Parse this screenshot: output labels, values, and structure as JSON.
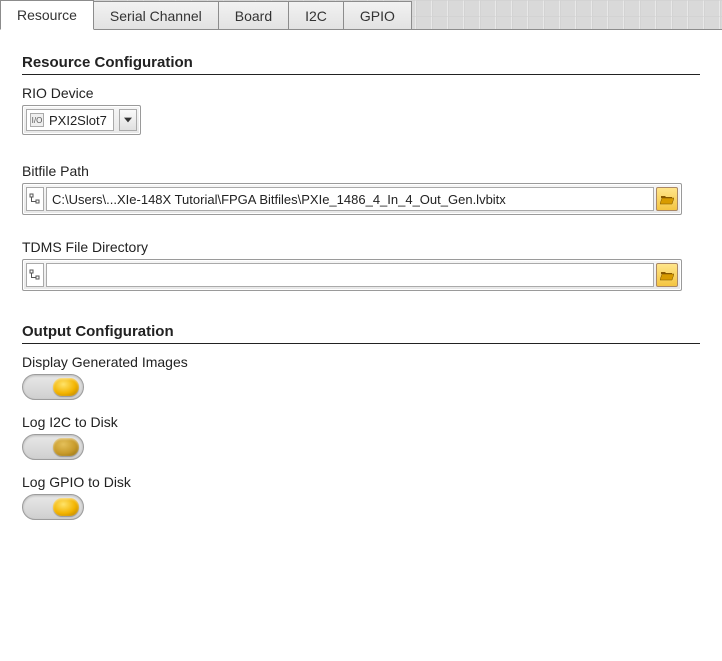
{
  "tabs": {
    "items": [
      {
        "label": "Resource",
        "active": true
      },
      {
        "label": "Serial Channel",
        "active": false
      },
      {
        "label": "Board",
        "active": false
      },
      {
        "label": "I2C",
        "active": false
      },
      {
        "label": "GPIO",
        "active": false
      }
    ]
  },
  "sections": {
    "resource_config": {
      "title": "Resource Configuration",
      "rio_device": {
        "label": "RIO Device",
        "value": "PXI2Slot7",
        "icon_name": "io-resource-icon"
      },
      "bitfile_path": {
        "label": "Bitfile Path",
        "value": "C:\\Users\\...XIe-148X Tutorial\\FPGA Bitfiles\\PXIe_1486_4_In_4_Out_Gen.lvbitx"
      },
      "tdms_dir": {
        "label": "TDMS File Directory",
        "value": ""
      }
    },
    "output_config": {
      "title": "Output Configuration",
      "display_generated": {
        "label": "Display Generated Images",
        "value": true
      },
      "log_i2c": {
        "label": "Log I2C to Disk",
        "value": true
      },
      "log_gpio": {
        "label": "Log GPIO to Disk",
        "value": true
      }
    }
  },
  "icons": {
    "dropdown": "chevron-down-icon",
    "browse": "folder-open-icon",
    "path": "path-tree-icon"
  }
}
